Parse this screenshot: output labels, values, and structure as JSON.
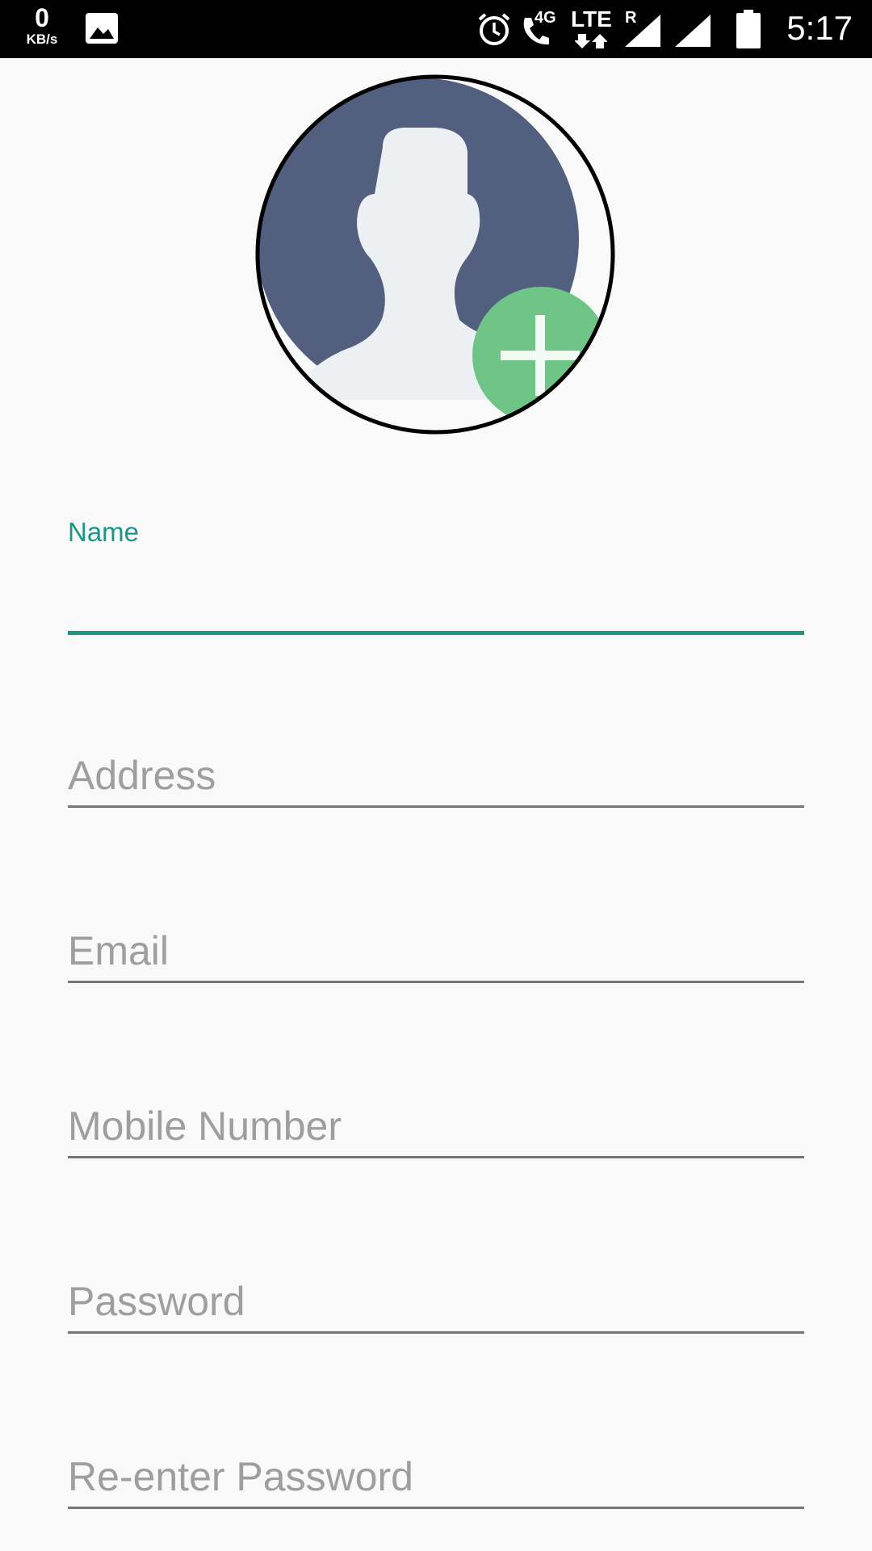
{
  "status_bar": {
    "net_speed_value": "0",
    "net_speed_unit": "KB/s",
    "network_4g": "4G",
    "network_lte": "LTE",
    "roaming": "R",
    "time": "5:17"
  },
  "avatar": {
    "add_icon": "plus-icon",
    "accent_color": "#6fc585",
    "silhouette_bg": "#525f7f"
  },
  "form": {
    "name": {
      "label": "Name",
      "value": "",
      "placeholder": ""
    },
    "address": {
      "placeholder": "Address",
      "value": ""
    },
    "email": {
      "placeholder": "Email",
      "value": ""
    },
    "mobile": {
      "placeholder": "Mobile Number",
      "value": ""
    },
    "password": {
      "placeholder": "Password",
      "value": ""
    },
    "reenter_password": {
      "placeholder": "Re-enter Password",
      "value": ""
    }
  },
  "colors": {
    "accent": "#1a9688",
    "underline": "#757575",
    "placeholder": "#9e9e9e",
    "background": "#f9f9fa"
  }
}
